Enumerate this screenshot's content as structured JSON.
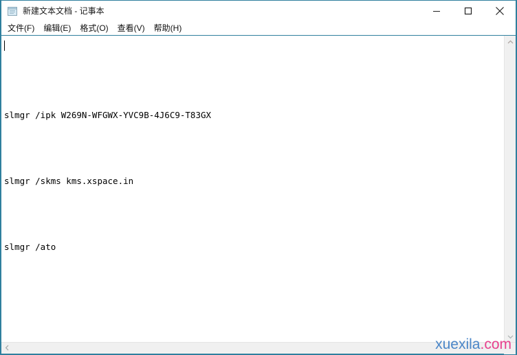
{
  "window": {
    "title": "新建文本文档 - 记事本",
    "icon": "notepad-icon",
    "border_color": "#2f7f9e",
    "background": "#ffffff"
  },
  "titlebar": {
    "minimize_label": "最小化",
    "maximize_label": "最大化",
    "close_label": "关闭",
    "minimize_icon": "minimize-icon",
    "maximize_icon": "maximize-icon",
    "close_icon": "close-icon"
  },
  "menubar": {
    "items": [
      {
        "label": "文件(F)",
        "name": "menu-file"
      },
      {
        "label": "编辑(E)",
        "name": "menu-edit"
      },
      {
        "label": "格式(O)",
        "name": "menu-format"
      },
      {
        "label": "查看(V)",
        "name": "menu-view"
      },
      {
        "label": "帮助(H)",
        "name": "menu-help"
      }
    ]
  },
  "document": {
    "lines": [
      "slmgr /ipk W269N-WFGWX-YVC9B-4J6C9-T83GX",
      "",
      "slmgr /skms kms.xspace.in",
      "",
      "slmgr /ato"
    ],
    "text_color": "#000000",
    "background": "#ffffff"
  },
  "scrollbars": {
    "vertical": {
      "up_arrow_icon": "chevron-up-icon",
      "down_arrow_icon": "chevron-down-icon",
      "track_color": "#f0f0f0"
    },
    "horizontal": {
      "left_arrow_icon": "chevron-left-icon",
      "track_color": "#f0f0f0"
    }
  },
  "watermark": {
    "primary": "xuexila",
    "suffix": ".com",
    "primary_color": "#4a86c8",
    "suffix_color": "#e8418e"
  }
}
